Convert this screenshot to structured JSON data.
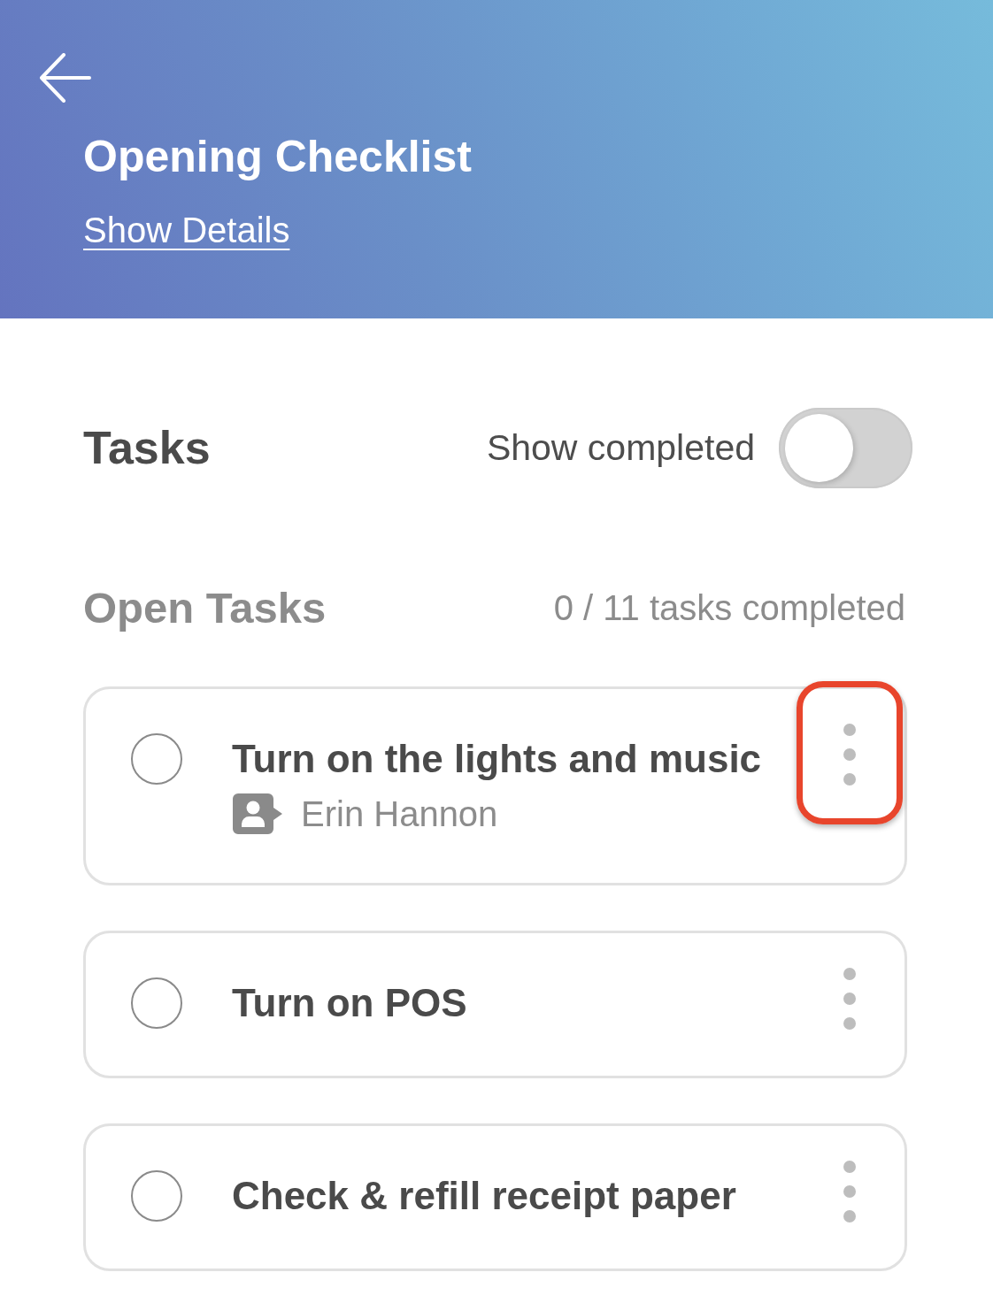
{
  "header": {
    "title": "Opening Checklist",
    "details_link": "Show Details"
  },
  "tasks_section": {
    "title": "Tasks",
    "show_completed": {
      "label": "Show completed",
      "on": false
    }
  },
  "open_tasks": {
    "title": "Open Tasks",
    "progress": "0 / 11 tasks completed",
    "items": [
      {
        "title": "Turn on the lights and music",
        "checked": false,
        "assignee": "Erin Hannon",
        "highlighted": true
      },
      {
        "title": "Turn on POS",
        "checked": false,
        "highlighted": false
      },
      {
        "title": "Check & refill receipt paper",
        "checked": false,
        "highlighted": false
      }
    ]
  }
}
